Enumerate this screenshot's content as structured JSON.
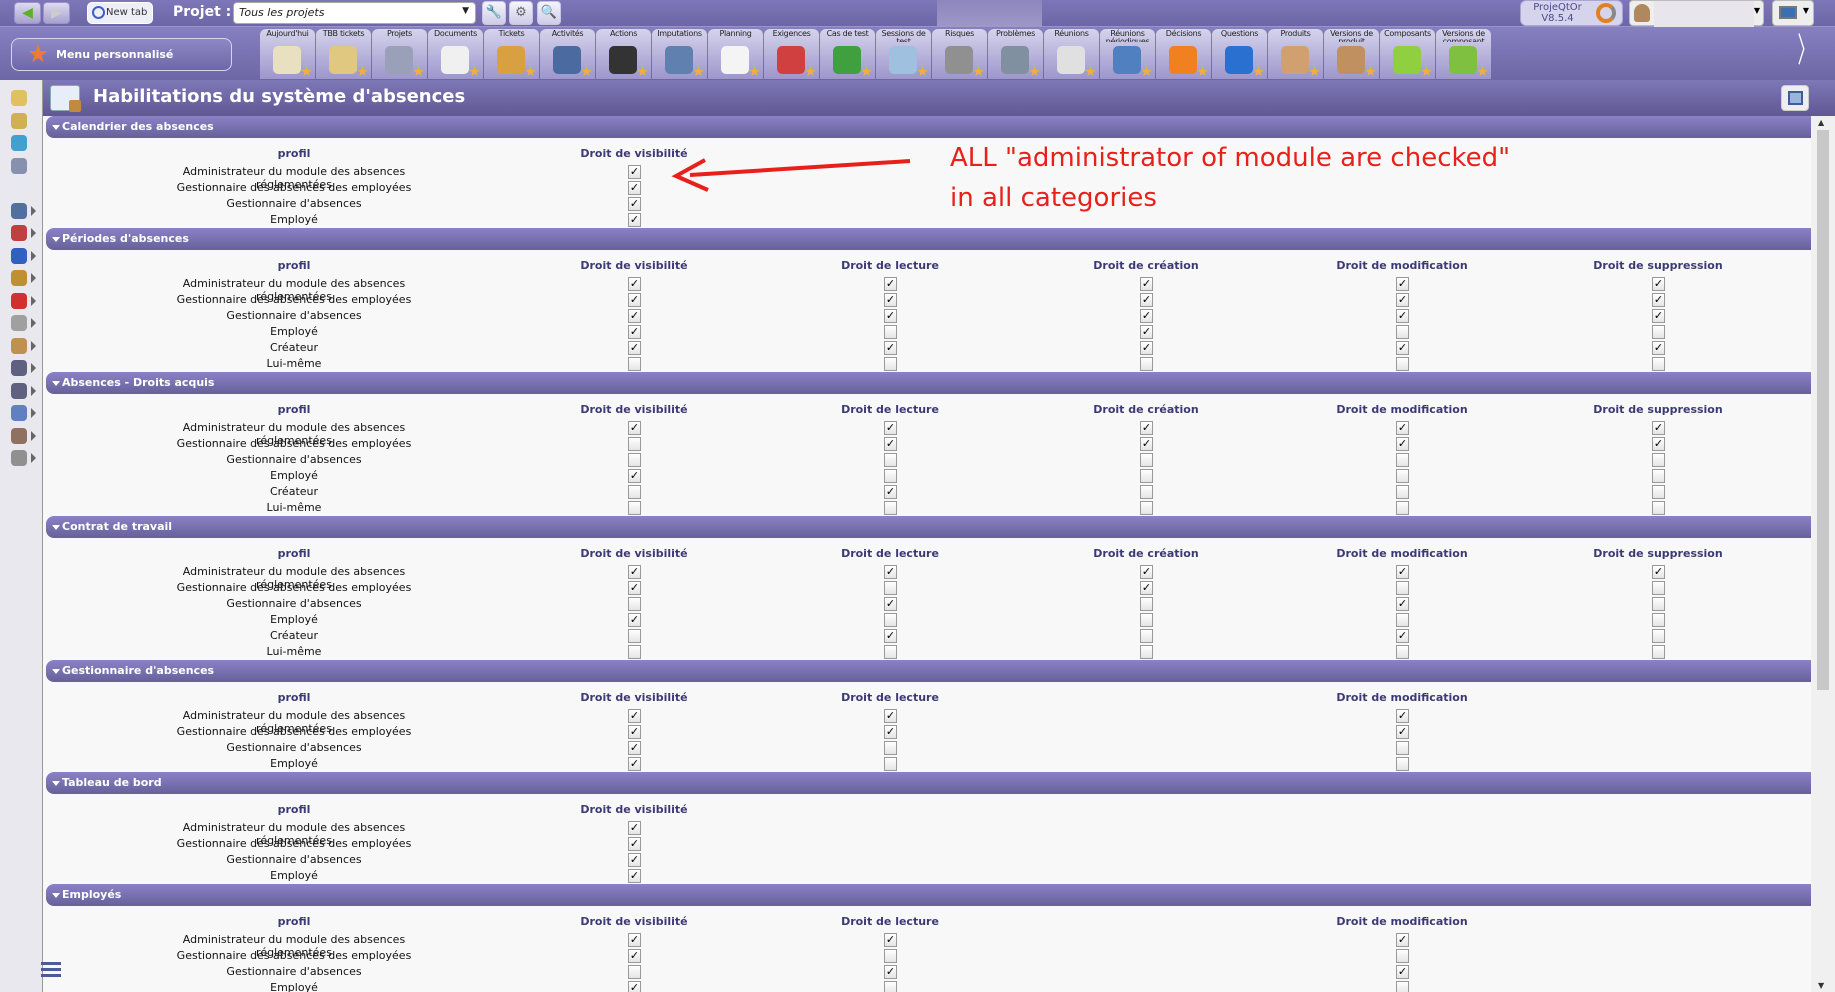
{
  "topbar": {
    "new_tab": "New tab",
    "project_label": "Projet :",
    "project_value": "Tous les projets",
    "version": "ProjeQtOr V8.5.4"
  },
  "toolbar": {
    "menu_label": "Menu personnalisé",
    "items": [
      "Aujourd'hui",
      "TBB tickets",
      "Projets",
      "Documents",
      "Tickets",
      "Activités",
      "Actions",
      "Imputations",
      "Planning",
      "Exigences",
      "Cas de test",
      "Sessions de test",
      "Risques",
      "Problèmes",
      "Réunions",
      "Réunions périodiques",
      "Décisions",
      "Questions",
      "Produits",
      "Versions de produit",
      "Composants",
      "Versions de composant"
    ],
    "icon_colors": [
      "#e8e0c0",
      "#e0c880",
      "#9aa0b8",
      "#f0f0f0",
      "#d8a040",
      "#4a6aa0",
      "#333333",
      "#6080b0",
      "#f4f4f4",
      "#d04040",
      "#40a040",
      "#a0c0e0",
      "#909090",
      "#8090a0",
      "#e0e0e0",
      "#5080c0",
      "#f08020",
      "#2a70d0",
      "#d0a070",
      "#c09060",
      "#90d040",
      "#80c040"
    ]
  },
  "page": {
    "title": "Habilitations du système d'absences"
  },
  "column_keys": [
    "visibility",
    "read",
    "create",
    "update",
    "delete"
  ],
  "sections": [
    {
      "title": "Calendrier des absences",
      "profile_header": "profil",
      "columns": [
        {
          "key": "visibility",
          "label": "Droit de visibilité"
        }
      ],
      "rows": [
        {
          "profile": "Administrateur du module des absences réglementées",
          "checks": [
            true
          ]
        },
        {
          "profile": "Gestionnaire des absences des employées",
          "checks": [
            true
          ]
        },
        {
          "profile": "Gestionnaire d'absences",
          "checks": [
            true
          ]
        },
        {
          "profile": "Employé",
          "checks": [
            true
          ]
        }
      ]
    },
    {
      "title": "Périodes d'absences",
      "profile_header": "profil",
      "columns": [
        {
          "key": "visibility",
          "label": "Droit de visibilité"
        },
        {
          "key": "read",
          "label": "Droit de lecture"
        },
        {
          "key": "create",
          "label": "Droit de création"
        },
        {
          "key": "update",
          "label": "Droit de modification"
        },
        {
          "key": "delete",
          "label": "Droit de suppression"
        }
      ],
      "rows": [
        {
          "profile": "Administrateur du module des absences réglementées",
          "checks": [
            true,
            true,
            true,
            true,
            true
          ]
        },
        {
          "profile": "Gestionnaire des absences des employées",
          "checks": [
            true,
            true,
            true,
            true,
            true
          ]
        },
        {
          "profile": "Gestionnaire d'absences",
          "checks": [
            true,
            true,
            true,
            true,
            true
          ]
        },
        {
          "profile": "Employé",
          "checks": [
            true,
            false,
            true,
            false,
            false
          ]
        },
        {
          "profile": "Créateur",
          "checks": [
            true,
            true,
            true,
            true,
            true
          ]
        },
        {
          "profile": "Lui-même",
          "checks": [
            false,
            false,
            false,
            false,
            false
          ]
        }
      ]
    },
    {
      "title": "Absences - Droits acquis",
      "profile_header": "profil",
      "columns": [
        {
          "key": "visibility",
          "label": "Droit de visibilité"
        },
        {
          "key": "read",
          "label": "Droit de lecture"
        },
        {
          "key": "create",
          "label": "Droit de création"
        },
        {
          "key": "update",
          "label": "Droit de modification"
        },
        {
          "key": "delete",
          "label": "Droit de suppression"
        }
      ],
      "rows": [
        {
          "profile": "Administrateur du module des absences réglementées",
          "checks": [
            true,
            true,
            true,
            true,
            true
          ]
        },
        {
          "profile": "Gestionnaire des absences des employées",
          "checks": [
            false,
            true,
            true,
            true,
            true
          ]
        },
        {
          "profile": "Gestionnaire d'absences",
          "checks": [
            false,
            false,
            false,
            false,
            false
          ]
        },
        {
          "profile": "Employé",
          "checks": [
            true,
            false,
            false,
            false,
            false
          ]
        },
        {
          "profile": "Créateur",
          "checks": [
            false,
            true,
            false,
            false,
            false
          ]
        },
        {
          "profile": "Lui-même",
          "checks": [
            false,
            false,
            false,
            false,
            false
          ]
        }
      ]
    },
    {
      "title": "Contrat de travail",
      "profile_header": "profil",
      "columns": [
        {
          "key": "visibility",
          "label": "Droit de visibilité"
        },
        {
          "key": "read",
          "label": "Droit de lecture"
        },
        {
          "key": "create",
          "label": "Droit de création"
        },
        {
          "key": "update",
          "label": "Droit de modification"
        },
        {
          "key": "delete",
          "label": "Droit de suppression"
        }
      ],
      "rows": [
        {
          "profile": "Administrateur du module des absences réglementées",
          "checks": [
            true,
            true,
            true,
            true,
            true
          ]
        },
        {
          "profile": "Gestionnaire des absences des employées",
          "checks": [
            true,
            false,
            true,
            false,
            false
          ]
        },
        {
          "profile": "Gestionnaire d'absences",
          "checks": [
            false,
            true,
            false,
            true,
            false
          ]
        },
        {
          "profile": "Employé",
          "checks": [
            true,
            false,
            false,
            false,
            false
          ]
        },
        {
          "profile": "Créateur",
          "checks": [
            false,
            true,
            false,
            true,
            false
          ]
        },
        {
          "profile": "Lui-même",
          "checks": [
            false,
            false,
            false,
            false,
            false
          ]
        }
      ]
    },
    {
      "title": "Gestionnaire d'absences",
      "profile_header": "profil",
      "columns": [
        {
          "key": "visibility",
          "label": "Droit de visibilité"
        },
        {
          "key": "read",
          "label": "Droit de lecture"
        },
        {
          "key": "update",
          "label": "Droit de modification"
        }
      ],
      "rows": [
        {
          "profile": "Administrateur du module des absences réglementées",
          "checks": [
            true,
            true,
            true
          ]
        },
        {
          "profile": "Gestionnaire des absences des employées",
          "checks": [
            true,
            true,
            true
          ]
        },
        {
          "profile": "Gestionnaire d'absences",
          "checks": [
            true,
            false,
            false
          ]
        },
        {
          "profile": "Employé",
          "checks": [
            true,
            false,
            false
          ]
        }
      ]
    },
    {
      "title": "Tableau de bord",
      "profile_header": "profil",
      "columns": [
        {
          "key": "visibility",
          "label": "Droit de visibilité"
        }
      ],
      "rows": [
        {
          "profile": "Administrateur du module des absences réglementées",
          "checks": [
            true
          ]
        },
        {
          "profile": "Gestionnaire des absences des employées",
          "checks": [
            true
          ]
        },
        {
          "profile": "Gestionnaire d'absences",
          "checks": [
            true
          ]
        },
        {
          "profile": "Employé",
          "checks": [
            true
          ]
        }
      ]
    },
    {
      "title": "Employés",
      "profile_header": "profil",
      "columns": [
        {
          "key": "visibility",
          "label": "Droit de visibilité"
        },
        {
          "key": "read",
          "label": "Droit de lecture"
        },
        {
          "key": "update",
          "label": "Droit de modification"
        }
      ],
      "rows": [
        {
          "profile": "Administrateur du module des absences réglementées",
          "checks": [
            true,
            true,
            true
          ]
        },
        {
          "profile": "Gestionnaire des absences des employées",
          "checks": [
            true,
            false,
            false
          ]
        },
        {
          "profile": "Gestionnaire d'absences",
          "checks": [
            false,
            true,
            true
          ]
        },
        {
          "profile": "Employé",
          "checks": [
            true,
            false,
            false
          ]
        }
      ]
    }
  ],
  "annotation": {
    "line1": "ALL \"administrator of module are checked\"",
    "line2": "in all categories",
    "color": "#e8201c"
  },
  "check_glyph": "✓"
}
